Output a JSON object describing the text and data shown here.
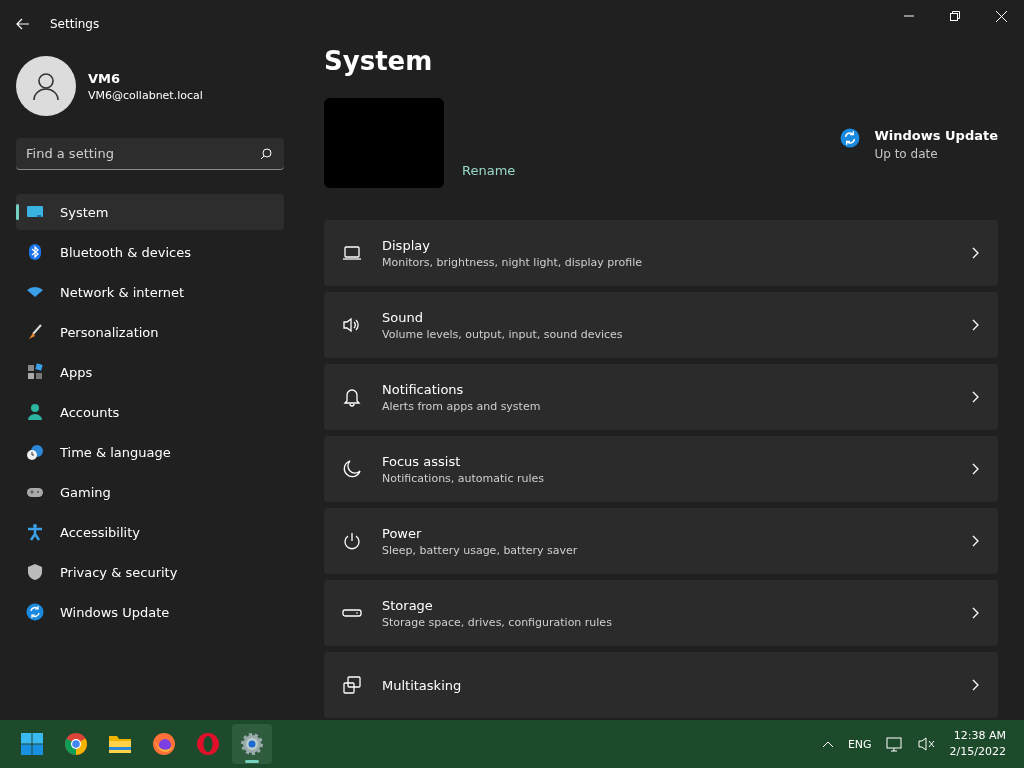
{
  "window": {
    "title": "Settings"
  },
  "account": {
    "name": "VM6",
    "email": "VM6@collabnet.local"
  },
  "search": {
    "placeholder": "Find a setting"
  },
  "sidebar": {
    "items": [
      {
        "label": "System",
        "kind": "system",
        "selected": true
      },
      {
        "label": "Bluetooth & devices",
        "kind": "bluetooth",
        "selected": false
      },
      {
        "label": "Network & internet",
        "kind": "network",
        "selected": false
      },
      {
        "label": "Personalization",
        "kind": "brush",
        "selected": false
      },
      {
        "label": "Apps",
        "kind": "apps",
        "selected": false
      },
      {
        "label": "Accounts",
        "kind": "accounts",
        "selected": false
      },
      {
        "label": "Time & language",
        "kind": "time",
        "selected": false
      },
      {
        "label": "Gaming",
        "kind": "gaming",
        "selected": false
      },
      {
        "label": "Accessibility",
        "kind": "accessibility",
        "selected": false
      },
      {
        "label": "Privacy & security",
        "kind": "privacy",
        "selected": false
      },
      {
        "label": "Windows Update",
        "kind": "update",
        "selected": false
      }
    ]
  },
  "page": {
    "title": "System",
    "rename": "Rename",
    "update": {
      "title": "Windows Update",
      "status": "Up to date"
    }
  },
  "cards": [
    {
      "kind": "display",
      "title": "Display",
      "subtitle": "Monitors, brightness, night light, display profile"
    },
    {
      "kind": "sound",
      "title": "Sound",
      "subtitle": "Volume levels, output, input, sound devices"
    },
    {
      "kind": "notifications",
      "title": "Notifications",
      "subtitle": "Alerts from apps and system"
    },
    {
      "kind": "focus",
      "title": "Focus assist",
      "subtitle": "Notifications, automatic rules"
    },
    {
      "kind": "power",
      "title": "Power",
      "subtitle": "Sleep, battery usage, battery saver"
    },
    {
      "kind": "storage",
      "title": "Storage",
      "subtitle": "Storage space, drives, configuration rules"
    },
    {
      "kind": "multitasking",
      "title": "Multitasking"
    }
  ],
  "taskbar": {
    "apps": [
      {
        "kind": "start",
        "selected": false
      },
      {
        "kind": "chrome",
        "selected": false
      },
      {
        "kind": "folder",
        "selected": false
      },
      {
        "kind": "firefox",
        "selected": false
      },
      {
        "kind": "opera",
        "selected": false
      },
      {
        "kind": "settings",
        "selected": true
      }
    ],
    "language": "ENG",
    "time": "12:38 AM",
    "date": "2/15/2022"
  }
}
